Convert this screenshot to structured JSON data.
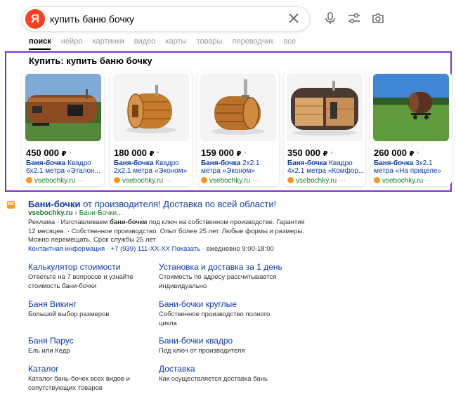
{
  "search": {
    "query": "купить баню бочку",
    "logo": "Я"
  },
  "icons": {
    "clear": "close-icon",
    "mic": "microphone-icon",
    "filters": "sliders-icon",
    "camera": "camera-icon"
  },
  "tabs": [
    "поиск",
    "нейро",
    "картинки",
    "видео",
    "карты",
    "товары",
    "переводчик",
    "все"
  ],
  "shopping": {
    "title": "Купить: купить баню бочку",
    "products": [
      {
        "price": "450 000",
        "name_bold": "Баня-бочка",
        "name_rest": " Квадро",
        "line2": "6х2.1 метра «Эталон...",
        "shop": "vsebochky.ru"
      },
      {
        "price": "180 000",
        "name_bold": "Баня-бочка",
        "name_rest": " Квадро",
        "line2": "2х2.1 метра «Эконом»",
        "shop": "vsebochky.ru"
      },
      {
        "price": "159 000",
        "name_bold": "Баня-бочка",
        "name_rest": " 2х2.1",
        "line2": "метра «Эконом»",
        "shop": "vsebochky.ru"
      },
      {
        "price": "350 000",
        "name_bold": "Баня-бочка",
        "name_rest": " Квадро",
        "line2": "4х2.1 метра «Комфор...",
        "shop": "vsebochky.ru"
      },
      {
        "price": "260 000",
        "name_bold": "Баня-бочка",
        "name_rest": " 3х2.1",
        "line2": "метра «На прицепе»",
        "shop": "vsebochky.ru"
      }
    ],
    "currency": "₽",
    "asterisk": "*",
    "more": "···"
  },
  "ad": {
    "favicon": "BB",
    "title_bold": "Бани-бочки",
    "title_rest": " от производителя! Доставка по всей области!",
    "url_domain": "vsebochky.ru",
    "url_path": " › Бани-Бочки...",
    "desc_1": "Реклама · Изготавливаем ",
    "desc_bold": "бани-бочки",
    "desc_2": " под ключ на собственном производстве. Гарантия 12 месяцев. · Собственное производство. Опыт более 25 лет. Любые формы и размеры. Можно перемещать. Срок службы 25 лет",
    "contact": "Контактная информация · +7 (939) 111-XX-XX Показать",
    "hours": "· ежедневно 9:00-18:00",
    "sitelinks": [
      {
        "title": "Калькулятор стоимости",
        "desc": "Ответьте на 7 вопросов и узнайте стоимость бани-бочки"
      },
      {
        "title": "Установка и доставка за 1 день",
        "desc": "Стоимость по адресу рассчитывается индивидуально"
      },
      {
        "title": "Баня Викинг",
        "desc": "Большой выбор размеров"
      },
      {
        "title": "Бани-бочки круглые",
        "desc": "Собственное производство полного цикла"
      },
      {
        "title": "Баня Парус",
        "desc": "Ель или Кедр"
      },
      {
        "title": "Бани-бочки квадро",
        "desc": "Под ключ от производителя"
      },
      {
        "title": "Каталог",
        "desc": "Каталог бань-бочек всех видов и сопутствующих товаров"
      },
      {
        "title": "Доставка",
        "desc": "Как осуществляется доставка бань"
      }
    ]
  }
}
